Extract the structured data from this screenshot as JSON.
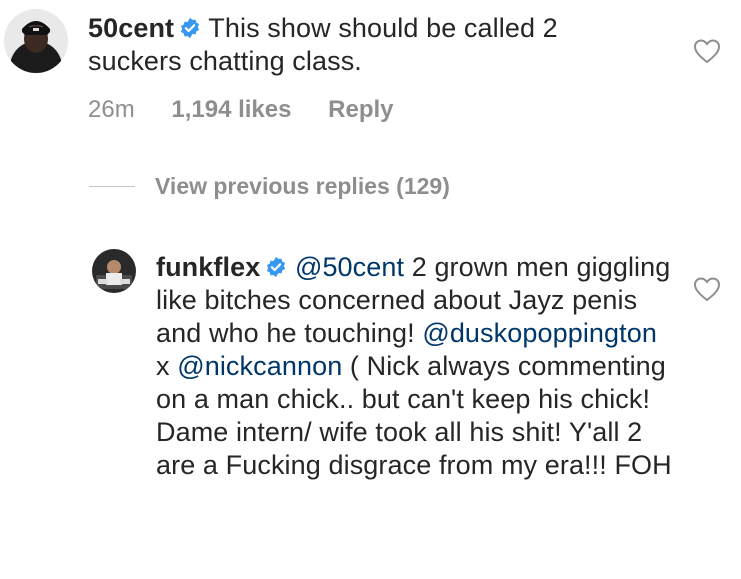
{
  "comment": {
    "username": "50cent",
    "text": "This show should be called 2 suckers chatting class.",
    "time": "26m",
    "likes": "1,194 likes",
    "reply_label": "Reply",
    "avatar_icon": "user-avatar-icon",
    "verified_icon": "verified-badge-icon",
    "like_icon": "heart-outline-icon"
  },
  "view_previous": "View previous replies (129)",
  "reply": {
    "username": "funkflex",
    "mention1": "@50cent",
    "text1": " 2 grown men giggling like bitches concerned about Jayz penis and who he touching! ",
    "mention2": "@duskopoppington",
    "text2": " x ",
    "mention3": "@nickcannon",
    "text3": " ( Nick always commenting on a man chick.. but can't keep his chick! Dame intern/ wife took all his shit! Y'all 2 are a Fucking disgrace from my era!!! FOH",
    "avatar_icon": "user-avatar-icon",
    "verified_icon": "verified-badge-icon",
    "like_icon": "heart-outline-icon"
  },
  "colors": {
    "verified": "#3897f0",
    "mention": "#00376b",
    "muted": "#8e8e8e",
    "text": "#262626"
  }
}
